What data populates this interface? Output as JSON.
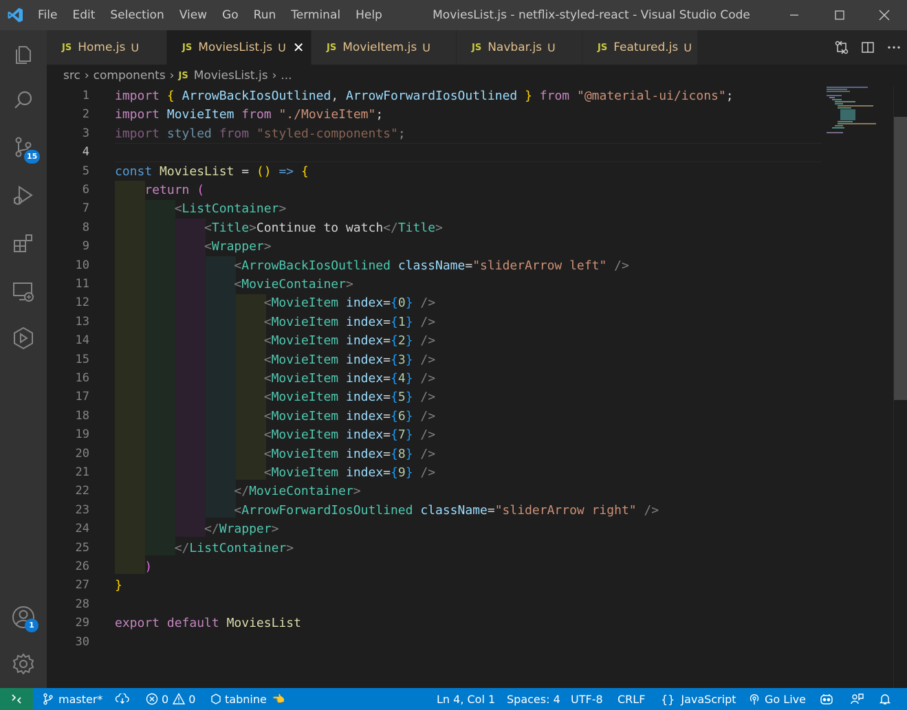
{
  "window": {
    "title": "MoviesList.js - netflix-styled-react - Visual Studio Code",
    "menu": [
      "File",
      "Edit",
      "Selection",
      "View",
      "Go",
      "Run",
      "Terminal",
      "Help"
    ]
  },
  "activity_bar": {
    "scm_badge": "15",
    "accounts_badge": "1"
  },
  "tabs": [
    {
      "icon": "JS",
      "label": "Home.js",
      "status": "U"
    },
    {
      "icon": "JS",
      "label": "MoviesList.js",
      "status": "U",
      "close": "✕"
    },
    {
      "icon": "JS",
      "label": "MovieItem.js",
      "status": "U"
    },
    {
      "icon": "JS",
      "label": "Navbar.js",
      "status": "U"
    },
    {
      "icon": "JS",
      "label": "Featured.js",
      "status": "U"
    }
  ],
  "breadcrumb": {
    "parts": [
      "src",
      "components"
    ],
    "file_icon": "JS",
    "file": "MoviesList.js",
    "more": "..."
  },
  "editor": {
    "line_numbers": [
      "1",
      "2",
      "3",
      "4",
      "5",
      "6",
      "7",
      "8",
      "9",
      "10",
      "11",
      "12",
      "13",
      "14",
      "15",
      "16",
      "17",
      "18",
      "19",
      "20",
      "21",
      "22",
      "23",
      "24",
      "25",
      "26",
      "27",
      "28",
      "29",
      "30"
    ],
    "current_line": 4
  },
  "statusbar": {
    "branch": "master*",
    "errors": "0",
    "warnings": "0",
    "tabnine": "tabnine",
    "position": "Ln 4, Col 1",
    "spaces": "Spaces: 4",
    "encoding": "UTF-8",
    "eol": "CRLF",
    "language_braces": "{}",
    "language": "JavaScript",
    "golive": "Go Live"
  },
  "colors": {
    "accent": "#007acc",
    "remote": "#16825d",
    "untracked": "#e2c08d"
  }
}
